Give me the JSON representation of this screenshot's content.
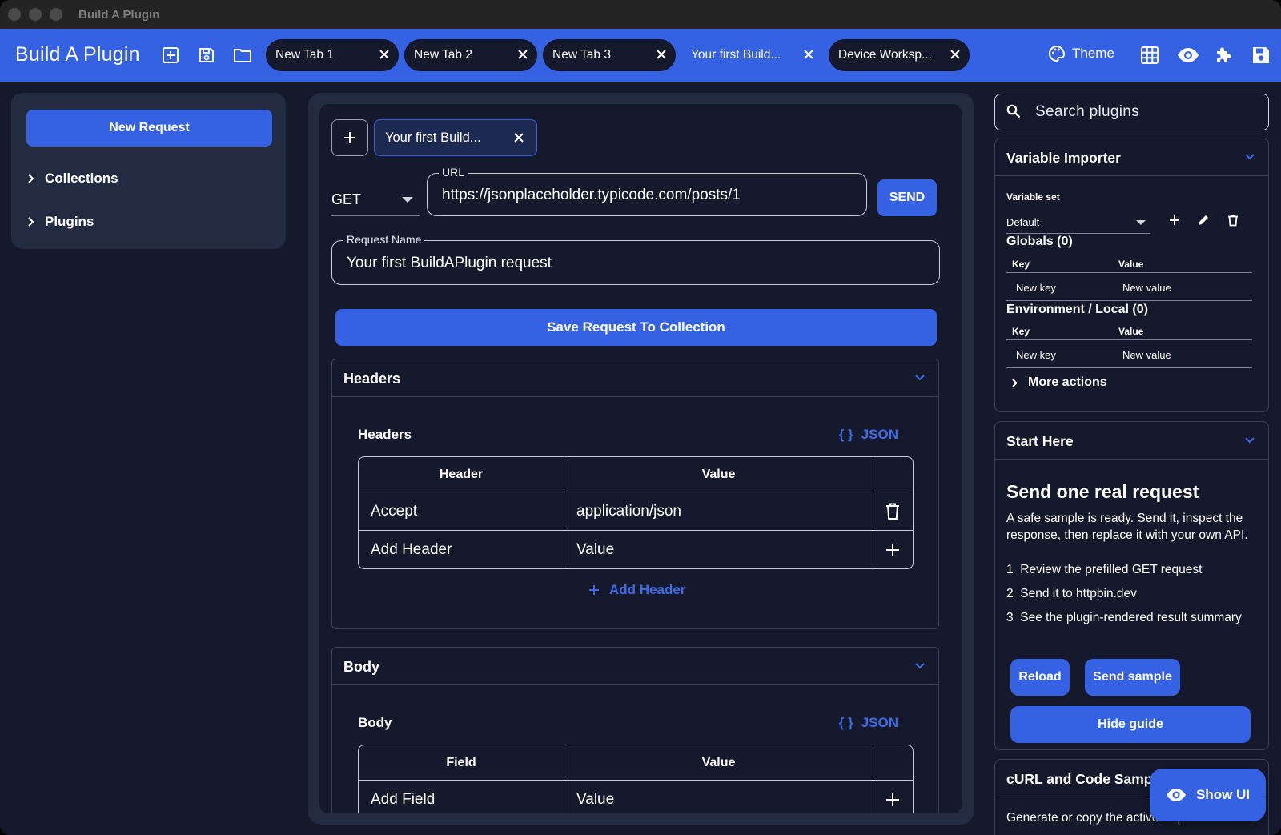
{
  "window": {
    "title": "Build A Plugin"
  },
  "appbar": {
    "brand": "Build A Plugin",
    "tabs": [
      {
        "label": "New Tab 1"
      },
      {
        "label": "New Tab 2"
      },
      {
        "label": "New Tab 3"
      },
      {
        "label": "Your first Build..."
      },
      {
        "label": "Device Worksp..."
      }
    ],
    "theme_label": "Theme"
  },
  "sidebar": {
    "new_request": "New Request",
    "items": [
      {
        "label": "Collections"
      },
      {
        "label": "Plugins"
      }
    ]
  },
  "request": {
    "tab_label": "Your first Build...",
    "method": "GET",
    "url_label": "URL",
    "url": "https://jsonplaceholder.typicode.com/posts/1",
    "send_label": "SEND",
    "name_label": "Request Name",
    "name": "Your first BuildAPlugin request",
    "save_label": "Save Request To Collection"
  },
  "headers_section": {
    "title": "Headers",
    "sub_title": "Headers",
    "json_label": "JSON",
    "columns": [
      "Header",
      "Value"
    ],
    "rows": [
      {
        "key": "Accept",
        "value": "application/json"
      }
    ],
    "add_row": {
      "key": "Add Header",
      "value": "Value"
    },
    "add_link": "Add Header"
  },
  "body_section": {
    "title": "Body",
    "sub_title": "Body",
    "json_label": "JSON",
    "columns": [
      "Field",
      "Value"
    ],
    "add_row": {
      "key": "Add Field",
      "value": "Value"
    }
  },
  "search": {
    "placeholder": "Search plugins"
  },
  "variable_importer": {
    "title": "Variable Importer",
    "set_label": "Variable set",
    "set_value": "Default",
    "globals_title": "Globals (0)",
    "env_title": "Environment / Local (0)",
    "col_key": "Key",
    "col_value": "Value",
    "new_key": "New key",
    "new_value": "New value",
    "more_actions": "More actions"
  },
  "start_here": {
    "title": "Start Here",
    "heading": "Send one real request",
    "intro": "A safe sample is ready. Send it, inspect the response, then replace it with your own API.",
    "steps": [
      {
        "num": "1",
        "text": "Review the prefilled GET request"
      },
      {
        "num": "2",
        "text": "Send it to httpbin.dev"
      },
      {
        "num": "3",
        "text": "See the plugin-rendered result summary"
      }
    ],
    "reload": "Reload",
    "send_sample": "Send sample",
    "hide_guide": "Hide guide"
  },
  "curl_card": {
    "title": "cURL and Code Samples",
    "desc": "Generate or copy the active request"
  },
  "show_ui": {
    "label": "Show UI"
  },
  "colors": {
    "accent": "#3561e3",
    "background": "#141a2c",
    "panel": "#222b3f",
    "link": "#3d6be8"
  }
}
